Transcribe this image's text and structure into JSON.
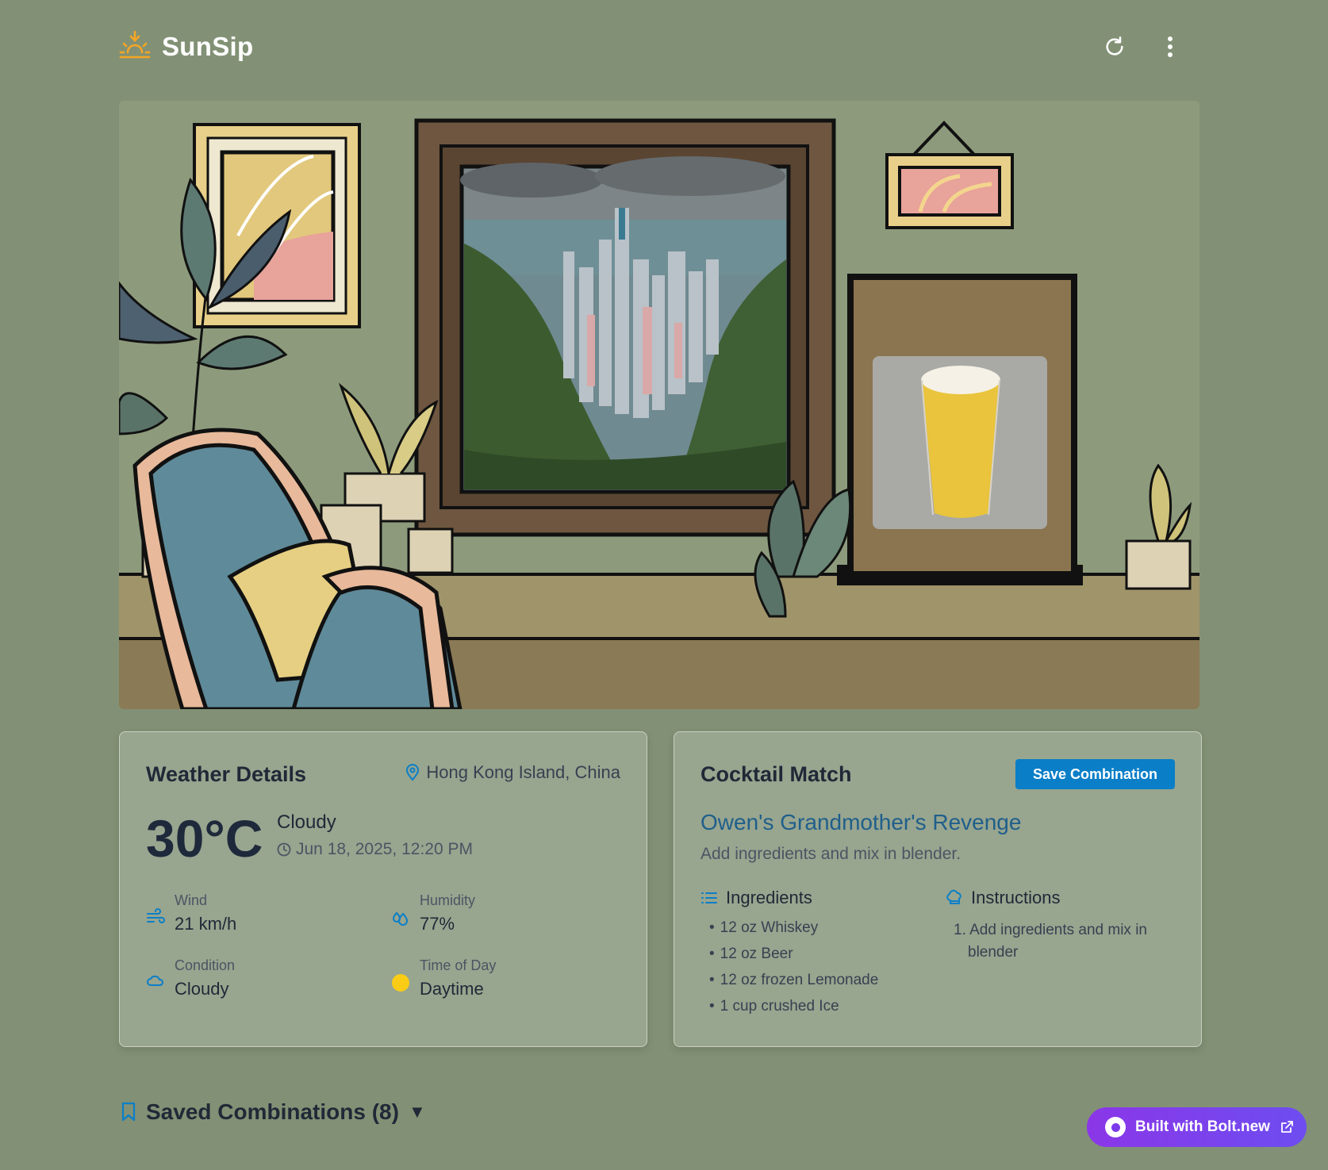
{
  "app": {
    "title": "SunSip"
  },
  "header": {
    "refresh_icon": "refresh-icon",
    "menu_icon": "more-vertical-icon"
  },
  "weather": {
    "title": "Weather Details",
    "location": "Hong Kong Island, China",
    "temperature": "30°C",
    "condition": "Cloudy",
    "datetime": "Jun 18, 2025, 12:20 PM",
    "stats": {
      "wind_label": "Wind",
      "wind_value": "21 km/h",
      "humidity_label": "Humidity",
      "humidity_value": "77%",
      "condition_label": "Condition",
      "condition_value": "Cloudy",
      "time_label": "Time of Day",
      "time_value": "Daytime"
    }
  },
  "cocktail": {
    "title": "Cocktail Match",
    "save_label": "Save Combination",
    "name": "Owen's Grandmother's Revenge",
    "description": "Add ingredients and mix in blender.",
    "ingredients_title": "Ingredients",
    "ingredients": [
      "12 oz Whiskey",
      "12 oz Beer",
      "12 oz frozen Lemonade",
      "1 cup crushed Ice"
    ],
    "instructions_title": "Instructions",
    "instructions": [
      "1. Add ingredients and mix in blender"
    ]
  },
  "saved": {
    "label": "Saved Combinations (8)",
    "caret": "▼"
  },
  "badge": {
    "label": "Built with Bolt.new"
  },
  "colors": {
    "background": "#829175",
    "card": "#98a58f",
    "accent_blue": "#0a7fc8",
    "drink_name": "#1f5f8b",
    "bolt_purple": "#7c3aed",
    "sun_yellow": "#facc15"
  }
}
